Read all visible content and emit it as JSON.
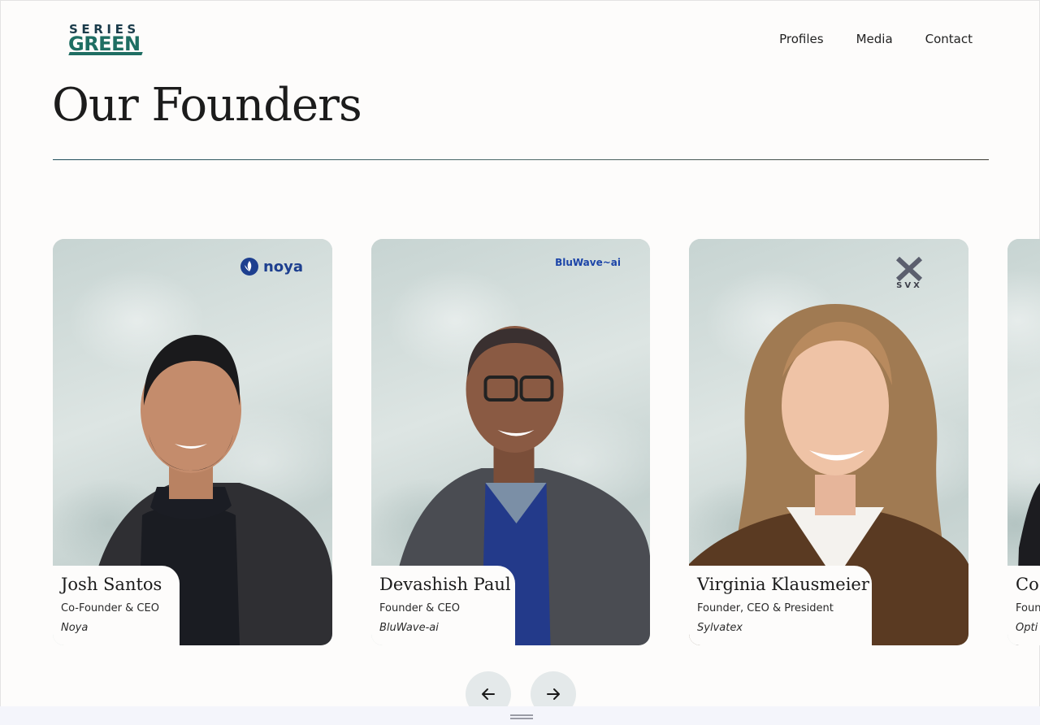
{
  "header": {
    "logo_line1": "SERIES",
    "logo_line2": "GREEN",
    "nav": [
      "Profiles",
      "Media",
      "Contact"
    ]
  },
  "page_title": "Our Founders",
  "founders": [
    {
      "name": "Josh Santos",
      "role": "Co-Founder & CEO",
      "company": "Noya",
      "brand_text": "noya",
      "brand_color": "#1d3f8f"
    },
    {
      "name": "Devashish Paul",
      "role": "Founder & CEO",
      "company": "BluWave-ai",
      "brand_text": "BluWave~ai",
      "brand_color": "#1b44a8"
    },
    {
      "name": "Virginia Klausmeier",
      "role": "Founder, CEO & President",
      "company": "Sylvatex",
      "brand_text": "SVX",
      "brand_color": "#3d3f4a"
    },
    {
      "name": "Co",
      "role": "Foun",
      "company": "Opti"
    }
  ],
  "carousel": {
    "prev_icon": "arrow-left-icon",
    "next_icon": "arrow-right-icon"
  },
  "colors": {
    "brand_green": "#1f6e63",
    "brand_navy": "#1a3b4a",
    "background": "#fdfcfb",
    "button_bg": "#e4e9ea"
  }
}
